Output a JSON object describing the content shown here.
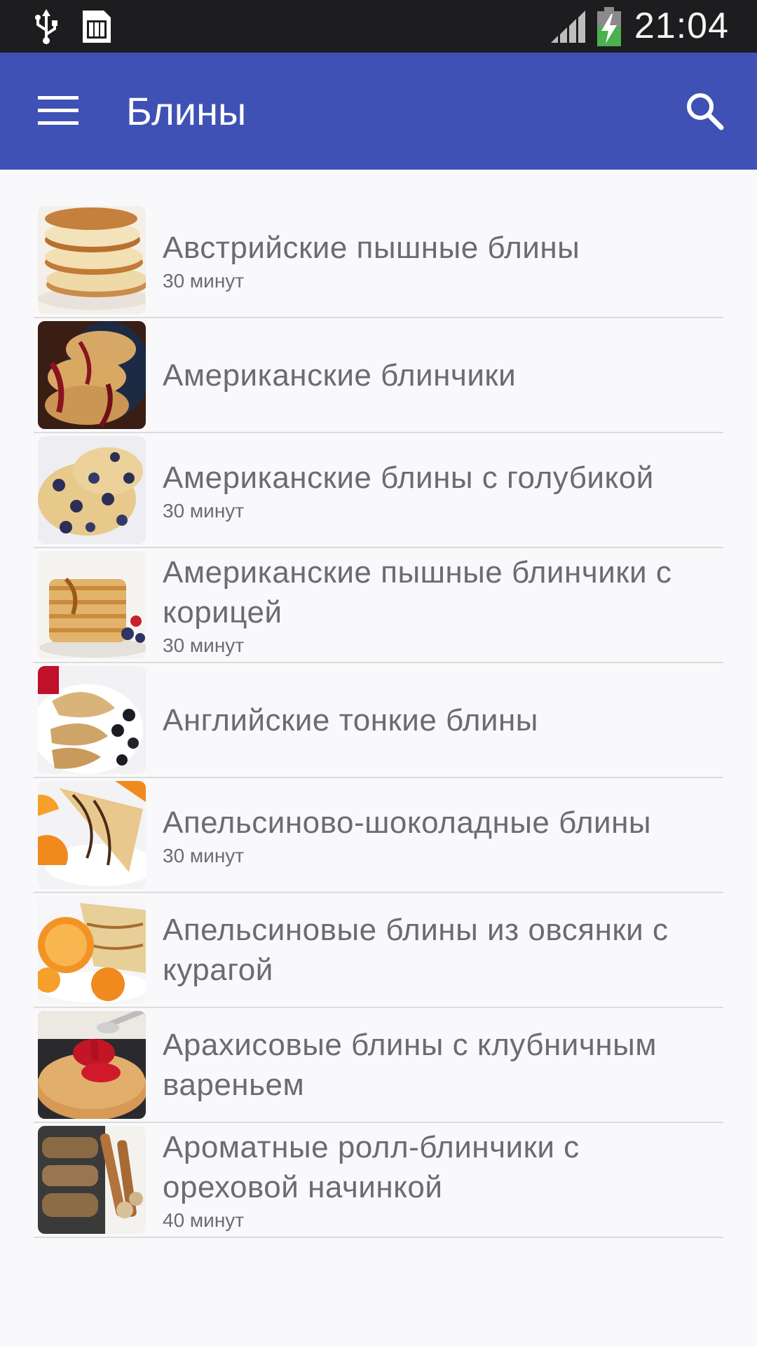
{
  "status_bar": {
    "time": "21:04",
    "icons": [
      "usb-icon",
      "sim-card-icon",
      "signal-icon",
      "battery-charging-icon"
    ]
  },
  "app_bar": {
    "title": "Блины",
    "menu_icon": "hamburger-menu-icon",
    "search_icon": "search-icon",
    "color": "#3f51b5"
  },
  "recipes": [
    {
      "title": "Австрийские пышные блины",
      "time": "30 минут"
    },
    {
      "title": "Американские блинчики",
      "time": ""
    },
    {
      "title": "Американские блины с голубикой",
      "time": "30 минут"
    },
    {
      "title": "Американские пышные блинчики с корицей",
      "time": "30 минут"
    },
    {
      "title": "Английские тонкие блины",
      "time": ""
    },
    {
      "title": "Апельсиново-шоколадные блины",
      "time": "30 минут"
    },
    {
      "title": "Апельсиновые блины из овсянки с курагой",
      "time": ""
    },
    {
      "title": "Арахисовые блины с клубничным вареньем",
      "time": ""
    },
    {
      "title": "Ароматные ролл-блинчики с ореховой начинкой",
      "time": "40 минут"
    }
  ]
}
